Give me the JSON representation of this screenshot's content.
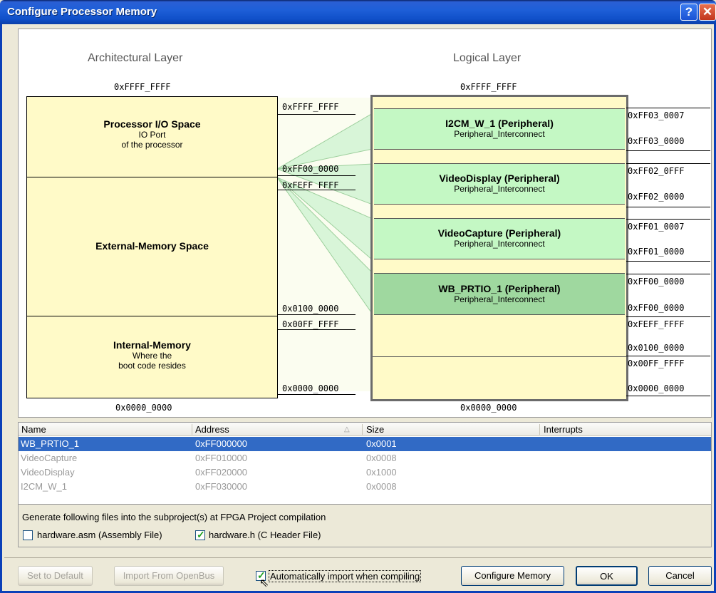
{
  "window": {
    "title": "Configure Processor Memory"
  },
  "arch": {
    "title": "Architectural Layer",
    "top_addr": "0xFFFF_FFFF",
    "bottom_addr": "0x0000_0000",
    "io": {
      "title": "Processor I/O Space",
      "line1": "IO Port",
      "line2": "of the processor",
      "addr_top": "0xFFFF_FFFF",
      "addr_bottom": "0xFF00_0000"
    },
    "ext": {
      "title": "External-Memory Space",
      "addr_top": "0xFEFF_FFFF",
      "addr_bottom": "0x0100_0000"
    },
    "int": {
      "title": "Internal-Memory",
      "line1": "Where the",
      "line2": "boot code resides",
      "addr_top": "0x00FF_FFFF",
      "addr_bottom": "0x0000_0000"
    }
  },
  "logical": {
    "title": "Logical Layer",
    "top_addr": "0xFFFF_FFFF",
    "bottom_addr": "0x0000_0000",
    "peripherals": [
      {
        "name": "I2CM_W_1 (Peripheral)",
        "bus": "Peripheral_Interconnect",
        "hi": "0xFF03_0007",
        "lo": "0xFF03_0000"
      },
      {
        "name": "VideoDisplay (Peripheral)",
        "bus": "Peripheral_Interconnect",
        "hi": "0xFF02_0FFF",
        "lo": "0xFF02_0000"
      },
      {
        "name": "VideoCapture (Peripheral)",
        "bus": "Peripheral_Interconnect",
        "hi": "0xFF01_0007",
        "lo": "0xFF01_0000"
      },
      {
        "name": "WB_PRTIO_1 (Peripheral)",
        "bus": "Peripheral_Interconnect",
        "hi": "0xFF00_0000",
        "lo": "0xFF00_0000"
      }
    ],
    "ext_hi": "0xFEFF_FFFF",
    "ext_lo": "0x0100_0000",
    "int_hi": "0x00FF_FFFF",
    "int_lo": "0x0000_0000"
  },
  "table": {
    "headers": {
      "name": "Name",
      "address": "Address",
      "size": "Size",
      "interrupts": "Interrupts"
    },
    "rows": [
      {
        "name": "WB_PRTIO_1",
        "address": "0xFF000000",
        "size": "0x0001",
        "interrupts": ""
      },
      {
        "name": "VideoCapture",
        "address": "0xFF010000",
        "size": "0x0008",
        "interrupts": ""
      },
      {
        "name": "VideoDisplay",
        "address": "0xFF020000",
        "size": "0x1000",
        "interrupts": ""
      },
      {
        "name": "I2CM_W_1",
        "address": "0xFF030000",
        "size": "0x0008",
        "interrupts": ""
      }
    ]
  },
  "generate": {
    "label": "Generate following files into the subproject(s) at FPGA Project compilation",
    "asm_label": "hardware.asm (Assembly File)",
    "asm_checked": false,
    "h_label": "hardware.h (C Header File)",
    "h_checked": true
  },
  "footer": {
    "set_default": "Set to Default",
    "import_openbus": "Import From OpenBus",
    "auto_import_label": "Automatically import when compiling",
    "auto_import_checked": true,
    "configure_memory": "Configure Memory",
    "ok": "OK",
    "cancel": "Cancel"
  },
  "colors": {
    "title_bar": "#1e5fd8",
    "memory_block": "#fffac8",
    "peripheral": "#c4f8c4",
    "selected_peripheral": "#9fd89f",
    "selection": "#316ac5"
  }
}
